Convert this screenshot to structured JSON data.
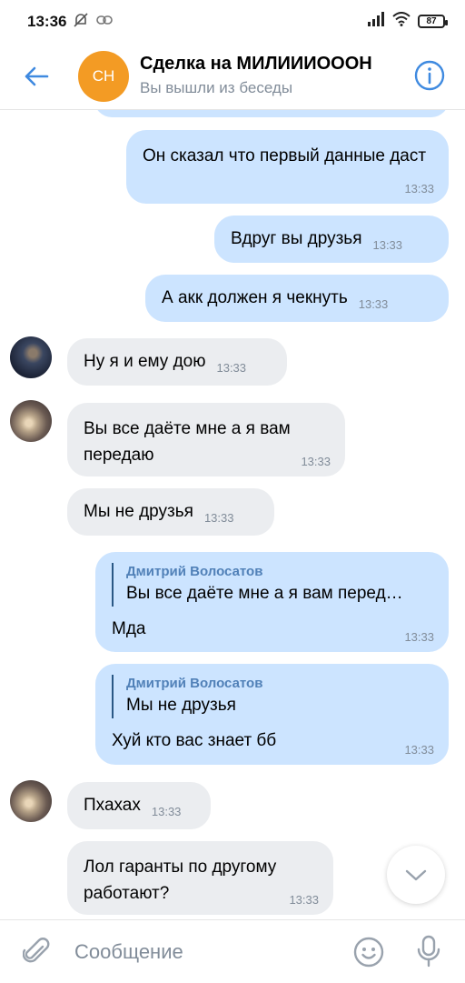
{
  "status_bar": {
    "time": "13:36",
    "battery": "87"
  },
  "header": {
    "avatar_initials": "СН",
    "title": "Сделка на МИЛИИИОООН",
    "subtitle": "Вы вышли из беседы"
  },
  "messages": [
    {
      "text": "Он сказал что первый данные даст",
      "time": "13:33"
    },
    {
      "text": "Вдруг вы друзья",
      "time": "13:33"
    },
    {
      "text": "А акк должен я чекнуть",
      "time": "13:33"
    },
    {
      "text": "Ну я и ему дою",
      "time": "13:33"
    },
    {
      "text": "Вы все даёте мне а я вам передаю",
      "time": "13:33"
    },
    {
      "text": "Мы не друзья",
      "time": "13:33"
    },
    {
      "reply_author": "Дмитрий Волосатов",
      "reply_text": "Вы все даёте мне а я вам перед…",
      "text": "Мда",
      "time": "13:33"
    },
    {
      "reply_author": "Дмитрий Волосатов",
      "reply_text": "Мы не друзья",
      "text": "Хуй кто вас знает бб",
      "time": "13:33"
    },
    {
      "text": "Пхахах",
      "time": "13:33"
    },
    {
      "text": "Лол гаранты по другому работают?",
      "time": "13:33"
    }
  ],
  "composer": {
    "placeholder": "Сообщение"
  },
  "colors": {
    "outgoing_bubble": "#cce4ff",
    "incoming_bubble": "#ebedf0",
    "accent": "#5181b8",
    "avatar": "#f39b24"
  }
}
